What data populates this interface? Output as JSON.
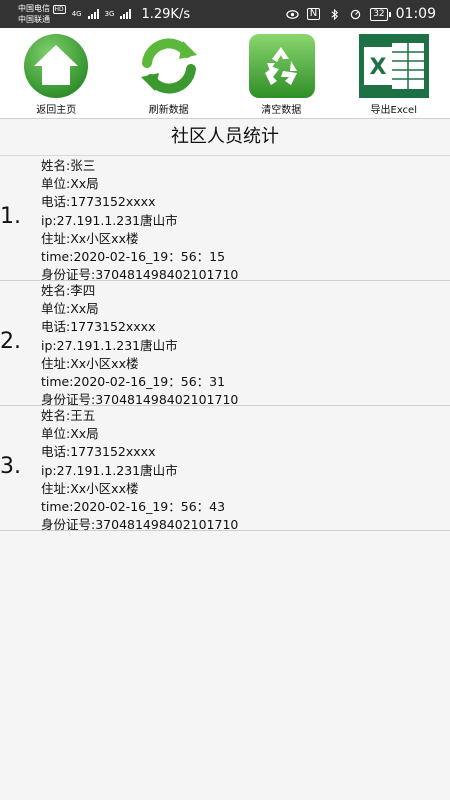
{
  "status_bar": {
    "carrier_1": "中国电信",
    "carrier_1_badge": "HD",
    "carrier_2": "中国联通",
    "net_type_1": "4G",
    "net_type_2": "3G",
    "net_speed": "1.29K/s",
    "nfc": "N",
    "battery": "32",
    "time": "01:09"
  },
  "toolbar": {
    "items": [
      {
        "label": "返回主页",
        "icon": "home-icon"
      },
      {
        "label": "刷新数据",
        "icon": "refresh-icon"
      },
      {
        "label": "清空数据",
        "icon": "recycle-icon"
      },
      {
        "label": "导出Excel",
        "icon": "excel-icon"
      }
    ]
  },
  "page": {
    "title": "社区人员统计"
  },
  "records": [
    {
      "index": "1.",
      "name": "姓名:张三",
      "unit": "单位:Xx局",
      "phone": "电话:1773152xxxx",
      "ip": "ip:27.191.1.231唐山市",
      "address": "住址:Xx小区xx楼",
      "time": "time:2020-02-16_19：56：15",
      "id_number": "身份证号:370481498402101710"
    },
    {
      "index": "2.",
      "name": "姓名:李四",
      "unit": "单位:Xx局",
      "phone": "电话:1773152xxxx",
      "ip": "ip:27.191.1.231唐山市",
      "address": "住址:Xx小区xx楼",
      "time": "time:2020-02-16_19：56：31",
      "id_number": "身份证号:370481498402101710"
    },
    {
      "index": "3.",
      "name": "姓名:王五",
      "unit": "单位:Xx局",
      "phone": "电话:1773152xxxx",
      "ip": "ip:27.191.1.231唐山市",
      "address": "住址:Xx小区xx楼",
      "time": "time:2020-02-16_19：56：43",
      "id_number": "身份证号:370481498402101710"
    }
  ],
  "colors": {
    "status_bar_bg": "#333333",
    "home_green": "#4caf3a",
    "refresh_green": "#3fa83a",
    "recycle_green": "#3da935",
    "excel_green": "#1e7145"
  }
}
